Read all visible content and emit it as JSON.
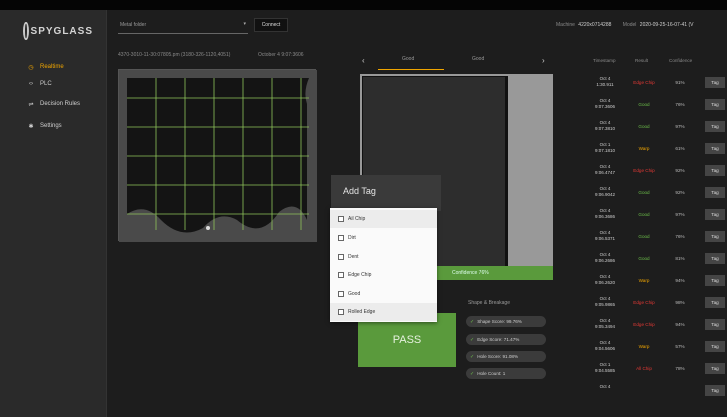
{
  "sidebar": {
    "logo": "SPYGLASS",
    "items": [
      {
        "label": "Realtime",
        "icon": "clock-icon",
        "active": true
      },
      {
        "label": "PLC",
        "icon": "code-icon",
        "active": false
      },
      {
        "label": "Decision Rules",
        "icon": "rules-icon",
        "active": false
      },
      {
        "label": "Settings",
        "icon": "gear-icon",
        "active": false
      }
    ]
  },
  "topbar": {
    "select_value": "Metal folder",
    "connect_label": "Connect",
    "machine_label": "Machine",
    "machine_value": "4220x0714288",
    "model_label": "Model",
    "model_value": "2020-09-25-16-07-41 (V"
  },
  "image_panel": {
    "image_id": "4370-3010-11-30:07805.pm (3180-326-1120,4051)",
    "date": "October 4 9:07:3606"
  },
  "tabs": {
    "prev": "‹",
    "next": "›",
    "items": [
      "Good",
      "Good"
    ]
  },
  "confidence_bar": "Confidence 76%",
  "section_label": "Shape & Breakage",
  "pass_label": "PASS",
  "chips": [
    "Shape Score: 99.76%",
    "Edge Score: 71.47%",
    "Hole Score: 91.08%",
    "Hole Count: 1"
  ],
  "modal": {
    "title": "Add Tag",
    "options": [
      {
        "label": "Ail Chip",
        "highlighted": true
      },
      {
        "label": "Dirt",
        "highlighted": false
      },
      {
        "label": "Dent",
        "highlighted": false
      },
      {
        "label": "Edge Chip",
        "highlighted": false
      },
      {
        "label": "Good",
        "highlighted": false
      },
      {
        "label": "Rolled Edge",
        "highlighted": true
      }
    ]
  },
  "table": {
    "headers": [
      "Timestamp",
      "Result",
      "Confidence"
    ],
    "rows": [
      {
        "date": "Oct 4",
        "time": "1:30.911",
        "result": "Edge Chip",
        "color": "#e53935",
        "conf": "91%",
        "action": "Tag"
      },
      {
        "date": "Oct 4",
        "time": "9:07.3606",
        "result": "Good",
        "color": "#6dbf4a",
        "conf": "76%",
        "action": "Tag"
      },
      {
        "date": "Oct 4",
        "time": "9:07.3810",
        "result": "Good",
        "color": "#6dbf4a",
        "conf": "97%",
        "action": "Tag"
      },
      {
        "date": "Oct 1",
        "time": "9:07.1810",
        "result": "Warp",
        "color": "#f0a500",
        "conf": "61%",
        "action": "Tag"
      },
      {
        "date": "Oct 4",
        "time": "9:06.4747",
        "result": "Edge Chip",
        "color": "#e53935",
        "conf": "92%",
        "action": "Tag"
      },
      {
        "date": "Oct 4",
        "time": "9:06.9042",
        "result": "Good",
        "color": "#6dbf4a",
        "conf": "92%",
        "action": "Tag"
      },
      {
        "date": "Oct 4",
        "time": "9:06.3686",
        "result": "Good",
        "color": "#6dbf4a",
        "conf": "97%",
        "action": "Tag"
      },
      {
        "date": "Oct 4",
        "time": "9:06.5371",
        "result": "Good",
        "color": "#6dbf4a",
        "conf": "76%",
        "action": "Tag"
      },
      {
        "date": "Oct 4",
        "time": "9:06.2686",
        "result": "Good",
        "color": "#6dbf4a",
        "conf": "81%",
        "action": "Tag"
      },
      {
        "date": "Oct 4",
        "time": "9:06.2620",
        "result": "Warp",
        "color": "#f0a500",
        "conf": "94%",
        "action": "Tag"
      },
      {
        "date": "Oct 4",
        "time": "9:05.9865",
        "result": "Edge Chip",
        "color": "#e53935",
        "conf": "98%",
        "action": "Tag"
      },
      {
        "date": "Oct 4",
        "time": "9:05.3494",
        "result": "Edge Chip",
        "color": "#e53935",
        "conf": "94%",
        "action": "Tag"
      },
      {
        "date": "Oct 4",
        "time": "9:04.5606",
        "result": "Warp",
        "color": "#f0a500",
        "conf": "57%",
        "action": "Tag"
      },
      {
        "date": "Oct 1",
        "time": "9:04.5585",
        "result": "All Chip",
        "color": "#e53935",
        "conf": "78%",
        "action": "Tag"
      },
      {
        "date": "Oct 4",
        "time": "",
        "result": "",
        "color": "#e53935",
        "conf": "",
        "action": "Tag"
      }
    ]
  }
}
